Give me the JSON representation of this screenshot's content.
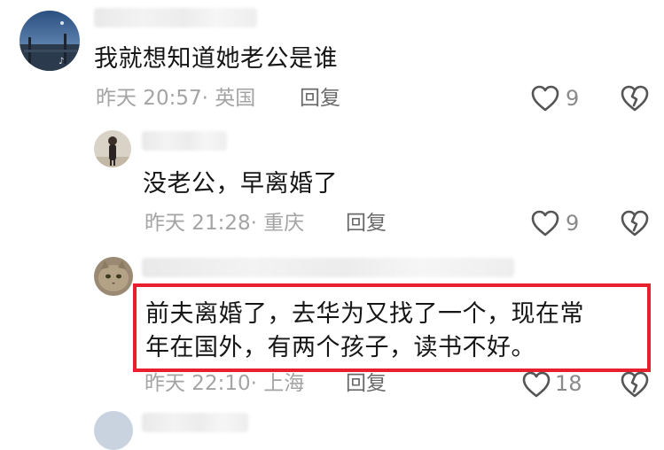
{
  "comments": [
    {
      "text": "我就想知道她老公是谁",
      "time": "昨天 20:57",
      "location": "· 英国",
      "reply_label": "回复",
      "likes": "9"
    },
    {
      "text": "没老公，早离婚了",
      "time": "昨天 21:28",
      "location": "· 重庆",
      "reply_label": "回复",
      "likes": "9"
    },
    {
      "text_line1": "前夫离婚了，去华为又找了一个，现在常",
      "text_line2": "年在国外，有两个孩子，读书不好。",
      "time": "昨天 22:10",
      "location": "· 上海",
      "reply_label": "回复",
      "likes": "18"
    }
  ],
  "colors": {
    "highlight": "#e8202e",
    "meta": "#a4a4a4",
    "reply": "#6a6a6a",
    "icon": "#555555"
  },
  "icons": [
    "heart-outline-icon",
    "broken-heart-icon"
  ]
}
